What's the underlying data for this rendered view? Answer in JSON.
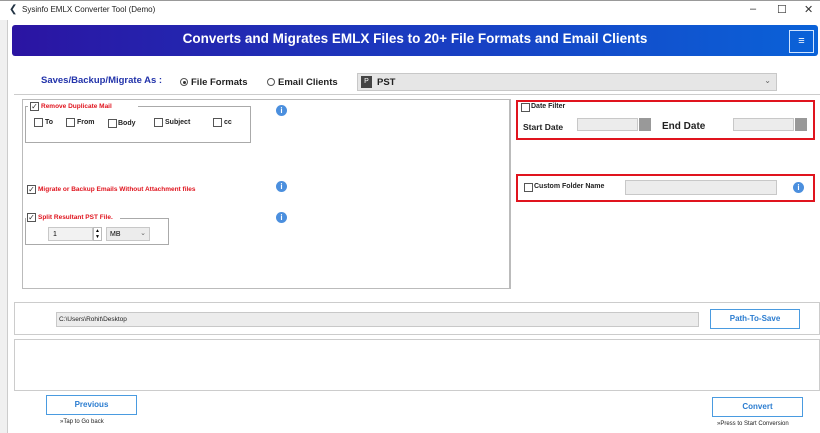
{
  "window": {
    "title": "Sysinfo EMLX Converter Tool (Demo)",
    "minimize": "–",
    "maximize": "☐",
    "close": "✕"
  },
  "banner": {
    "title": "Converts and Migrates EMLX Files to 20+ File Formats and Email Clients",
    "menu_icon": "≡"
  },
  "save_as": {
    "label": "Saves/Backup/Migrate As :",
    "options": [
      "File Formats",
      "Email Clients"
    ],
    "selected": "File Formats",
    "format": "PST"
  },
  "remove_duplicate": {
    "label": "Remove Duplicate Mail",
    "checked": true,
    "fields": [
      "To",
      "From",
      "Body",
      "Subject",
      "cc"
    ]
  },
  "without_attachment": {
    "label": "Migrate or Backup Emails Without Attachment files",
    "checked": true
  },
  "split": {
    "label": "Split Resultant PST File.",
    "checked": true,
    "value": "1",
    "unit": "MB"
  },
  "date_filter": {
    "label": "Date Filter",
    "start": "Start Date",
    "end": "End Date"
  },
  "custom_folder": {
    "label": "Custom Folder Name"
  },
  "path": {
    "value": "C:\\Users\\Rohit\\Desktop",
    "button": "Path-To-Save"
  },
  "footer": {
    "previous": "Previous",
    "previous_hint": "»Tap to Go back",
    "convert": "Convert",
    "convert_hint": "»Press to Start Conversion"
  },
  "colors": {
    "accent": "#2a7cd0",
    "warning": "#e0141e",
    "banner_start": "#2b14a2",
    "banner_end": "#0a62d8"
  }
}
